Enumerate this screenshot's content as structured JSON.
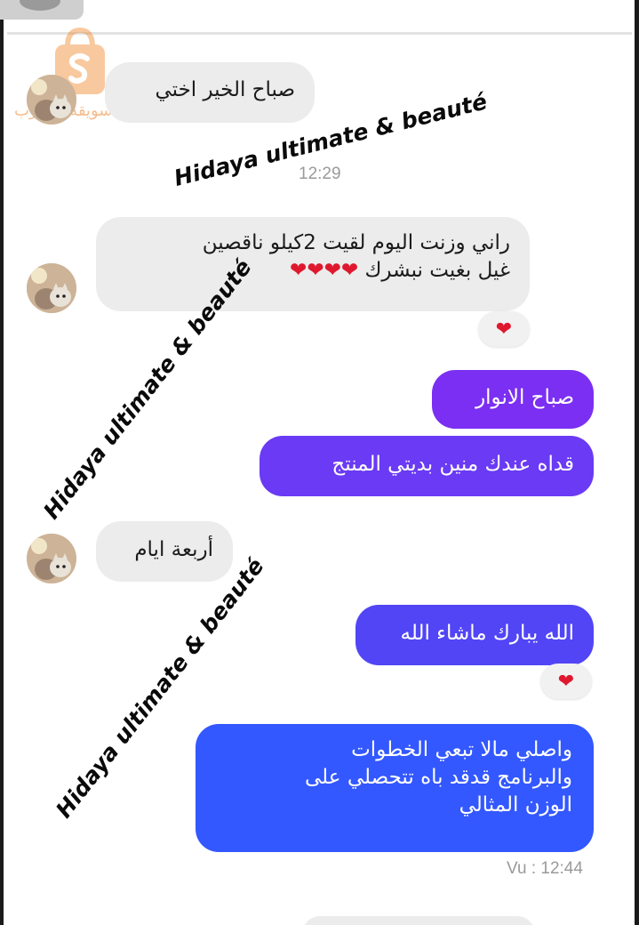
{
  "watermark": {
    "brand_text": "سويقة المغرب"
  },
  "overlay_caption": "Hidaya ultimate & beauté",
  "messages": {
    "m1": "صباح الخير اختي",
    "t1": "12:29",
    "m2_line1": "راني وزنت اليوم لقيت 2كيلو ناقصين",
    "m2_line2": "غيل بغيت نبشرك",
    "m2_hearts": "❤❤❤❤",
    "m2_reaction": "❤",
    "m3": "صباح الانوار",
    "m4": "قداه عندك منين بديتي المنتج",
    "m5": "أربعة ايام",
    "m6": "الله يبارك ماشاء الله",
    "m6_reaction": "❤",
    "m7_line1": "واصلي مالا تبعي الخطوات",
    "m7_line2": "والبرنامج قدقد باه تتحصلي على",
    "m7_line3": "الوزن المثالي",
    "t2": "Vu : 12:44"
  },
  "colors": {
    "incoming_bubble": "#ececec",
    "outgoing_purple": "#7b2ff2",
    "outgoing_blue": "#3358ff",
    "heart": "#e0182d"
  },
  "icons": {
    "avatar": "cat-avatar-icon",
    "watermark_logo": "shopping-bag-logo-icon"
  }
}
